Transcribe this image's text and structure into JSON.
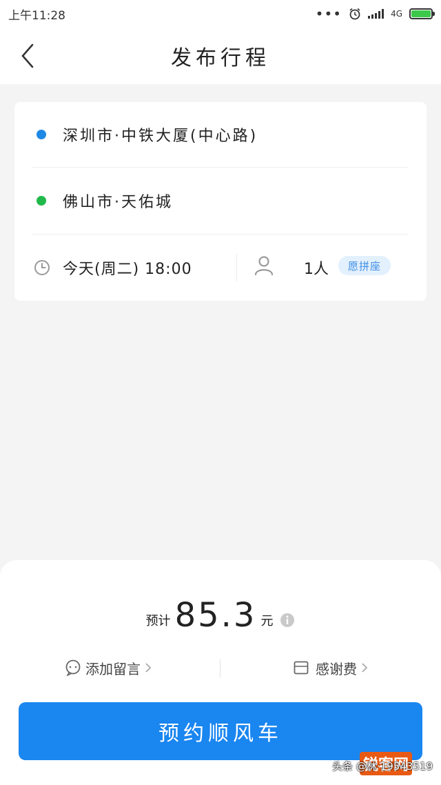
{
  "status_bar": {
    "time": "上午11:28",
    "network": "4G"
  },
  "header": {
    "title": "发布行程"
  },
  "trip": {
    "origin": "深圳市·中铁大厦(中心路)",
    "destination": "佛山市·天佑城",
    "departure_time": "今天(周二) 18:00",
    "passengers": "1人",
    "carpool_badge": "愿拼座"
  },
  "price": {
    "label": "预计",
    "value": "85.3",
    "unit": "元"
  },
  "actions": {
    "message_label": "添加留言",
    "fee_label": "感谢费"
  },
  "book_button": {
    "label": "预约顺风车"
  },
  "watermark": {
    "text": "头条 @林·19543519",
    "logo_text": "锐客网"
  },
  "colors": {
    "origin_dot": "#1e88e5",
    "destination_dot": "#21b94c",
    "primary": "#1a86f0",
    "badge_bg": "#e3f0fd",
    "badge_text": "#3d8fe6"
  },
  "icons": {
    "back": "chevron-left-icon",
    "clock": "clock-icon",
    "person": "person-icon",
    "info": "info-icon",
    "message": "chat-bubble-icon",
    "fee": "envelope-icon",
    "alarm": "alarm-icon"
  }
}
